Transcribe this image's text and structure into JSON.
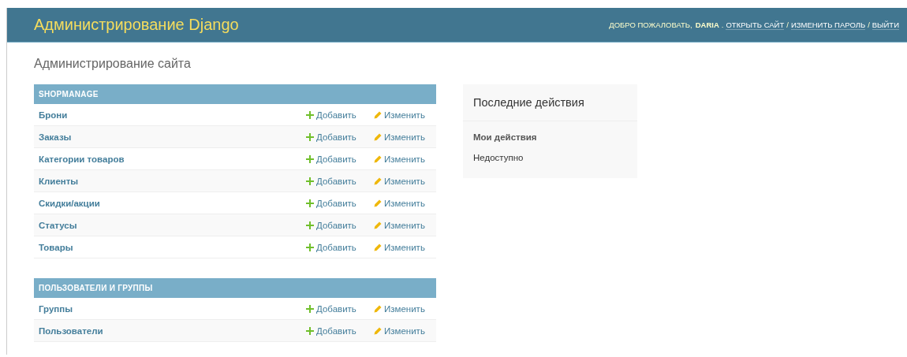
{
  "header": {
    "branding": "Администрирование Django",
    "user_tools": {
      "welcome": "ДОБРО ПОЖАЛОВАТЬ,",
      "username": "DARIA",
      "end_mark": ".",
      "separator": "/",
      "links": [
        "ОТКРЫТЬ САЙТ",
        "ИЗМЕНИТЬ ПАРОЛЬ",
        "ВЫЙТИ"
      ]
    }
  },
  "page_title": "Администрирование сайта",
  "modules": [
    {
      "caption": "SHOPMANAGE",
      "models": [
        {
          "name": "Брони",
          "add": "Добавить",
          "change": "Изменить"
        },
        {
          "name": "Заказы",
          "add": "Добавить",
          "change": "Изменить"
        },
        {
          "name": "Категории товаров",
          "add": "Добавить",
          "change": "Изменить"
        },
        {
          "name": "Клиенты",
          "add": "Добавить",
          "change": "Изменить"
        },
        {
          "name": "Скидки/акции",
          "add": "Добавить",
          "change": "Изменить"
        },
        {
          "name": "Статусы",
          "add": "Добавить",
          "change": "Изменить"
        },
        {
          "name": "Товары",
          "add": "Добавить",
          "change": "Изменить"
        }
      ]
    },
    {
      "caption": "ПОЛЬЗОВАТЕЛИ И ГРУППЫ",
      "models": [
        {
          "name": "Группы",
          "add": "Добавить",
          "change": "Изменить"
        },
        {
          "name": "Пользователи",
          "add": "Добавить",
          "change": "Изменить"
        }
      ]
    }
  ],
  "recent_actions": {
    "title": "Последние действия",
    "subtitle": "Мои действия",
    "empty": "Недоступно"
  }
}
